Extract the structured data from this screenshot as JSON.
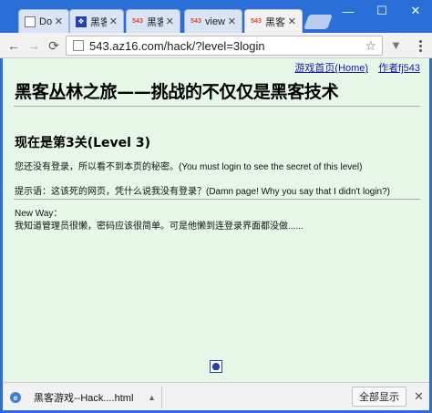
{
  "tabs": [
    {
      "icon": "doc-icon",
      "label": "Doc",
      "active": false
    },
    {
      "icon": "paw-icon",
      "label": "黑客",
      "active": false
    },
    {
      "icon": "543-icon",
      "label": "黑客",
      "active": false
    },
    {
      "icon": "543-icon",
      "label": "view",
      "active": false
    },
    {
      "icon": "543-icon",
      "label": "黑客",
      "active": true
    }
  ],
  "window": {
    "minimize": "—",
    "maximize": "☐",
    "close": "✕"
  },
  "toolbar": {
    "url": "543.az16.com/hack/?level=3login",
    "back": "←",
    "forward": "→",
    "reload": "⟳",
    "star": "☆"
  },
  "page": {
    "links": {
      "home": "游戏首页(Home)",
      "author": "作者fj543"
    },
    "title": "黑客丛林之旅——挑战的不仅仅是黑客技术",
    "level_heading": "现在是第3关(Level 3)",
    "message": "您还没有登录，所以看不到本页的秘密。(You must login to see the secret of this level)",
    "hint": "提示语：这该死的网页，凭什么说我没有登录？(Damn page! Why you say that I didn't login?)",
    "newway_label": "New Way：",
    "newway_text": "我知道管理员很懒，密码应该很简单。可是他懒到连登录界面都没做......"
  },
  "downloads": {
    "filename": "黑客游戏--Hack....html",
    "show_all": "全部显示",
    "close": "✕"
  },
  "colors": {
    "page_bg": "#e7f7e7",
    "chrome_blue": "#2a6fd8",
    "link": "#1a1aa6"
  }
}
